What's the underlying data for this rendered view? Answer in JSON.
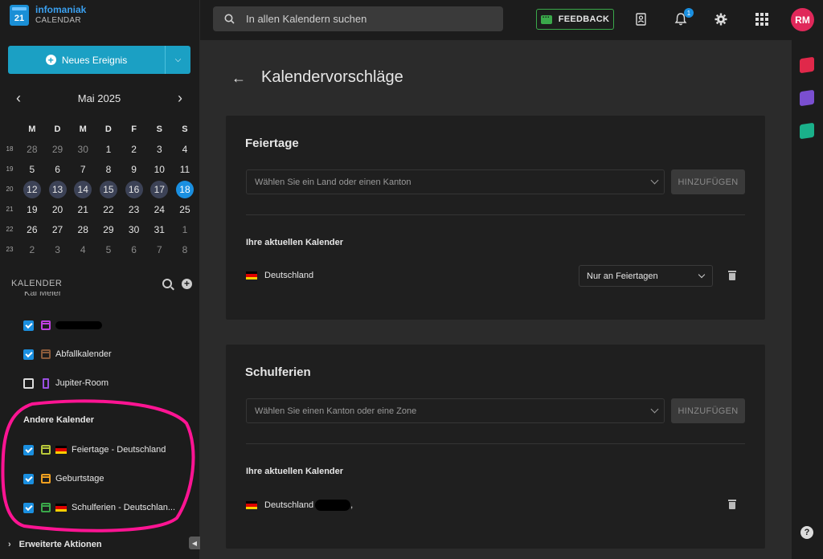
{
  "brand": {
    "name": "infomaniak",
    "product": "CALENDAR",
    "logo_number": "21"
  },
  "sidebar": {
    "new_event_label": "Neues Ereignis",
    "month_label": "Mai 2025",
    "weekdays": [
      "M",
      "D",
      "M",
      "D",
      "F",
      "S",
      "S"
    ],
    "weeks": [
      {
        "num": "18",
        "days": [
          "28",
          "29",
          "30",
          "1",
          "2",
          "3",
          "4"
        ]
      },
      {
        "num": "19",
        "days": [
          "5",
          "6",
          "7",
          "8",
          "9",
          "10",
          "11"
        ]
      },
      {
        "num": "20",
        "days": [
          "12",
          "13",
          "14",
          "15",
          "16",
          "17",
          "18"
        ]
      },
      {
        "num": "21",
        "days": [
          "19",
          "20",
          "21",
          "22",
          "23",
          "24",
          "25"
        ]
      },
      {
        "num": "22",
        "days": [
          "26",
          "27",
          "28",
          "29",
          "30",
          "31",
          "1"
        ]
      },
      {
        "num": "23",
        "days": [
          "2",
          "3",
          "4",
          "5",
          "6",
          "7",
          "8"
        ]
      }
    ],
    "calendars_heading": "KALENDER",
    "cut_label": "Kai Meier",
    "my_calendars": [
      {
        "label": "",
        "checked": true,
        "icon": "calendar-person-icon",
        "color": "#c040e0"
      },
      {
        "label": "Abfallkalender",
        "checked": true,
        "icon": "calendar-icon",
        "color": "#8a5a3a"
      },
      {
        "label": "Jupiter-Room",
        "checked": false,
        "icon": "door-icon",
        "color": "#9a4fe0"
      }
    ],
    "other_heading": "Andere Kalender",
    "other_calendars": [
      {
        "label": "Feiertage - Deutschland",
        "checked": true,
        "color": "#b8c83a"
      },
      {
        "label": "Geburtstage",
        "checked": true,
        "color": "#f0a020"
      },
      {
        "label": "Schulferien - Deutschlan...",
        "checked": true,
        "color": "#3aa84a"
      }
    ],
    "advanced_label": "Erweiterte Aktionen"
  },
  "topbar": {
    "search_placeholder": "In allen Kalendern suchen",
    "feedback_label": "FEEDBACK",
    "notification_count": "1",
    "avatar_initials": "RM"
  },
  "page": {
    "title": "Kalendervorschläge",
    "holidays": {
      "title": "Feiertage",
      "select_placeholder": "Wählen Sie ein Land oder einen Kanton",
      "add_label": "HINZUFÜGEN",
      "current_heading": "Ihre aktuellen Kalender",
      "current": [
        {
          "label": "Deutschland",
          "mode": "Nur an Feiertagen"
        }
      ]
    },
    "school": {
      "title": "Schulferien",
      "select_placeholder": "Wählen Sie einen Kanton oder eine Zone",
      "add_label": "HINZUFÜGEN",
      "current_heading": "Ihre aktuellen Kalender",
      "current": [
        {
          "label": "Deutschland",
          "suffix": ","
        }
      ]
    }
  },
  "help_label": "?"
}
